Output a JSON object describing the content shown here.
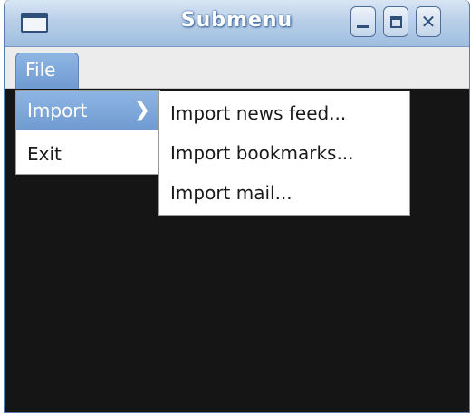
{
  "window": {
    "title": "Submenu",
    "icon": "window-icon",
    "controls": [
      "minimize",
      "maximize",
      "close"
    ],
    "controls_glyphs": {
      "close": "✕"
    }
  },
  "menubar": {
    "items": [
      {
        "label": "File",
        "active": true
      }
    ]
  },
  "file_menu": {
    "items": [
      {
        "label": "Import",
        "has_submenu": true,
        "highlighted": true,
        "chevron": "❯"
      },
      {
        "label": "Exit"
      }
    ]
  },
  "import_submenu": {
    "items": [
      {
        "label": "Import news feed..."
      },
      {
        "label": "Import bookmarks..."
      },
      {
        "label": "Import mail..."
      }
    ]
  },
  "colors": {
    "titlebar": "#b9cfe8",
    "highlight": "#7fa8db",
    "content_bg": "#151515",
    "menu_bg": "#ffffff"
  }
}
